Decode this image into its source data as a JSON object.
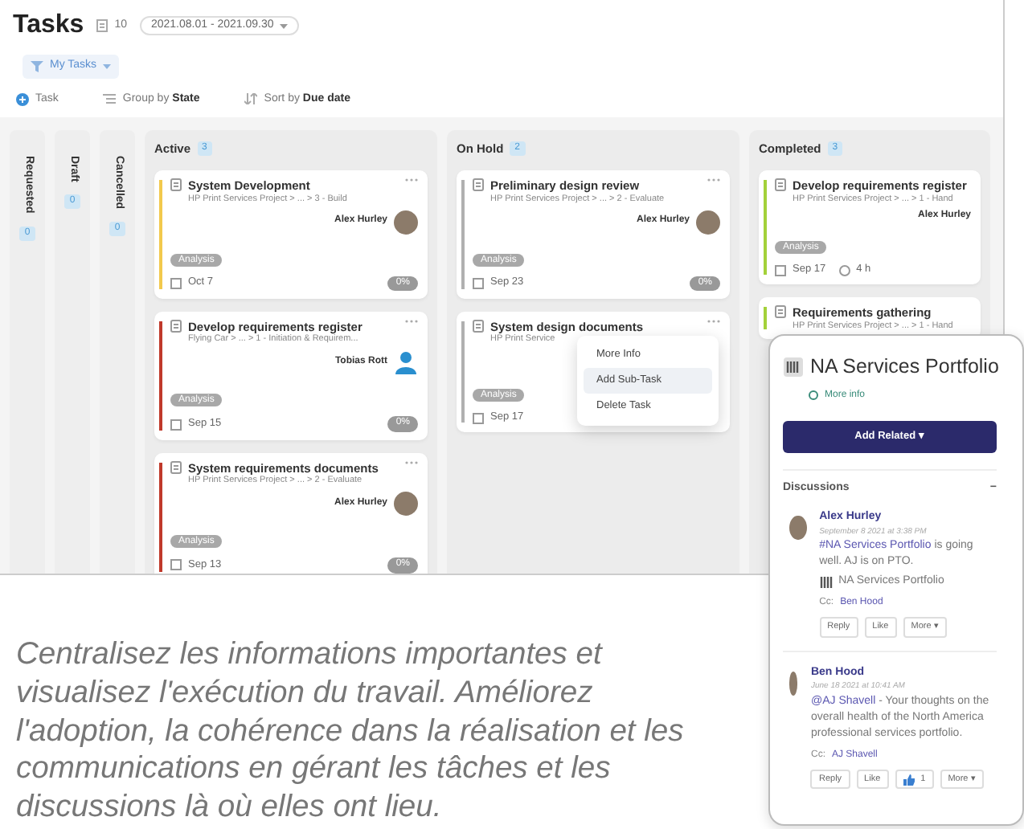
{
  "header": {
    "title": "Tasks",
    "count": "10",
    "date_range": "2021.08.01 - 2021.09.30",
    "view": "My Tasks"
  },
  "toolbar": [
    {
      "kind": "add",
      "label": "Task"
    },
    {
      "kind": "group",
      "label": "Group by **State**"
    },
    {
      "kind": "sort",
      "label": "Sort by **Due date**"
    }
  ],
  "collapsed_columns": [
    {
      "name": "Requested",
      "count": "0"
    },
    {
      "name": "Draft",
      "count": "0"
    },
    {
      "name": "Cancelled",
      "count": "0"
    }
  ],
  "columns": [
    {
      "name": "Active",
      "count": "3",
      "cards": [
        {
          "title": "System Development",
          "path": "HP Print Services Project > ... > 3 - Build",
          "assignee": "Alex Hurley",
          "avatar_photo": true,
          "tag": "Analysis",
          "date": "Oct 7",
          "progress": "0%",
          "color": "#f2c94c"
        },
        {
          "title": "Develop requirements register",
          "path": "Flying Car > ... > 1 - Initiation & Requirem...",
          "assignee": "Tobias Rott",
          "avatar_photo": false,
          "tag": "Analysis",
          "date": "Sep 15",
          "progress": "0%",
          "color": "#c0392b"
        },
        {
          "title": "System requirements documents",
          "path": "HP Print Services Project > ... > 2 - Evaluate",
          "assignee": "Alex Hurley",
          "avatar_photo": true,
          "tag": "Analysis",
          "date": "Sep 13",
          "progress": "0%",
          "color": "#c0392b"
        }
      ]
    },
    {
      "name": "On Hold",
      "count": "2",
      "cards": [
        {
          "title": "Preliminary design review",
          "path": "HP Print Services Project > ... > 2 - Evaluate",
          "assignee": "Alex Hurley",
          "avatar_photo": true,
          "tag": "Analysis",
          "date": "Sep 23",
          "progress": "0%",
          "color": "#b0b0b0"
        },
        {
          "title": "System design documents",
          "path": "HP Print Service",
          "tag": "Analysis",
          "date": "Sep 17",
          "color": "#b0b0b0",
          "menu": {
            "items": [
              {
                "label": "More Info",
                "selected": false
              },
              {
                "label": "Add Sub-Task",
                "selected": true
              },
              {
                "label": "Delete Task",
                "selected": false
              }
            ]
          }
        }
      ]
    },
    {
      "name": "Completed",
      "count": "3",
      "cards": [
        {
          "title": "Develop requirements register",
          "path": "HP Print Services Project > ... > 1 - Hand",
          "assignee": "Alex Hurley",
          "tag": "Analysis",
          "date": "Sep 17",
          "hours": "4 h",
          "color": "#a3d13a"
        },
        {
          "title": "Requirements gathering",
          "path": "HP Print Services Project > ... > 1 - Hand",
          "color": "#a3d13a"
        }
      ]
    }
  ],
  "panel": {
    "title": "NA Services Portfolio",
    "more_info": "More info",
    "button": "Add Related ▾",
    "section": "Discussions",
    "collapse": "−",
    "comments": [
      {
        "author": "Alex Hurley",
        "time": "September 8 2021 at 3:38 PM",
        "mention": "#NA Services Portfolio",
        "text": " is going well. AJ is on PTO.",
        "attachment": "NA Services Portfolio",
        "cc_label": "Cc:",
        "cc": "Ben Hood",
        "actions": [
          {
            "kind": "button",
            "label": "Reply"
          },
          {
            "kind": "button",
            "label": "Like"
          },
          {
            "kind": "button",
            "label": "More ▾"
          }
        ]
      },
      {
        "author": "Ben Hood",
        "time": "June 18 2021 at 10:41 AM",
        "mention": "@AJ Shavell",
        "text": " - Your thoughts on the overall health of the North America professional services portfolio.",
        "cc_label": "Cc:",
        "cc": "AJ Shavell",
        "actions": [
          {
            "kind": "button",
            "label": "Reply"
          },
          {
            "kind": "button",
            "label": "Like"
          },
          {
            "kind": "likes",
            "label": "1"
          },
          {
            "kind": "button",
            "label": "More ▾"
          }
        ]
      }
    ]
  },
  "caption": "Centralisez les informations importantes et visualisez l'exécution du travail. Améliorez l'adoption, la cohérence dans la réalisation et les communications en gérant les tâches et les discussions là où elles ont lieu."
}
